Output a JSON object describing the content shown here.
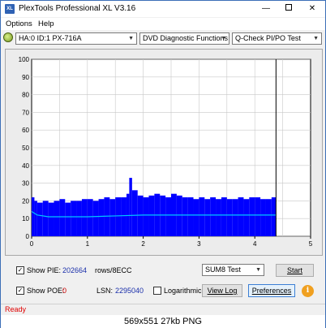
{
  "window": {
    "title": "PlexTools Professional XL V3.16",
    "icon_label": "XL",
    "minimize_glyph": "—",
    "close_glyph": "✕"
  },
  "menu": {
    "items": [
      "Options",
      "Help"
    ]
  },
  "toolbar": {
    "drive": "HA:0 ID:1  PX-716A",
    "function": "DVD Diagnostic Functions",
    "test": "Q-Check PI/PO Test",
    "chevron": "▼"
  },
  "chart_data": {
    "type": "bar",
    "x_ticks": [
      "0",
      "1",
      "2",
      "3",
      "4",
      "5"
    ],
    "y_ticks": [
      "0",
      "10",
      "20",
      "30",
      "40",
      "50",
      "60",
      "70",
      "80",
      "90",
      "100"
    ],
    "xlim": [
      0,
      5
    ],
    "ylim": [
      0,
      100
    ],
    "grid": true,
    "end_marker_x": 4.38,
    "series": [
      {
        "color": "#0000ff",
        "x": [
          0,
          0.05,
          0.1,
          0.2,
          0.3,
          0.4,
          0.5,
          0.6,
          0.7,
          0.8,
          0.9,
          1.0,
          1.1,
          1.2,
          1.3,
          1.4,
          1.5,
          1.6,
          1.7,
          1.75,
          1.8,
          1.9,
          2.0,
          2.1,
          2.2,
          2.3,
          2.4,
          2.5,
          2.6,
          2.7,
          2.8,
          2.9,
          3.0,
          3.1,
          3.2,
          3.3,
          3.4,
          3.5,
          3.6,
          3.7,
          3.8,
          3.9,
          4.0,
          4.1,
          4.2,
          4.3,
          4.38
        ],
        "values": [
          22,
          20,
          19,
          20,
          19,
          20,
          21,
          19,
          20,
          20,
          21,
          21,
          20,
          21,
          22,
          21,
          22,
          22,
          24,
          33,
          26,
          23,
          22,
          23,
          24,
          23,
          22,
          24,
          23,
          22,
          22,
          21,
          22,
          21,
          22,
          21,
          22,
          21,
          21,
          22,
          21,
          22,
          22,
          21,
          21,
          22,
          20
        ]
      },
      {
        "color": "#00c8ff",
        "x": [
          0,
          0.1,
          0.3,
          0.6,
          1.0,
          1.5,
          2.0,
          2.5,
          3.0,
          3.5,
          4.0,
          4.38
        ],
        "values": [
          14,
          12,
          11,
          11,
          11,
          11.5,
          12,
          12,
          12,
          12,
          12,
          12
        ]
      }
    ]
  },
  "controls": {
    "show_pie_label": "Show PIE:",
    "pie_value": "202664",
    "pie_unit": "rows/8ECC",
    "show_poe_label": "Show POE:",
    "poe_value": "0",
    "lsn_label": "LSN:",
    "lsn_value": "2295040",
    "logarithmic_label": "Logarithmic",
    "test_select": "SUM8 Test",
    "start_button": "Start",
    "view_log_button": "View Log",
    "preferences_button": "Preferences",
    "info_glyph": "i",
    "check_glyph": "✓"
  },
  "status": {
    "text": "Ready"
  },
  "caption": {
    "text": "569x551  27kb  PNG"
  }
}
